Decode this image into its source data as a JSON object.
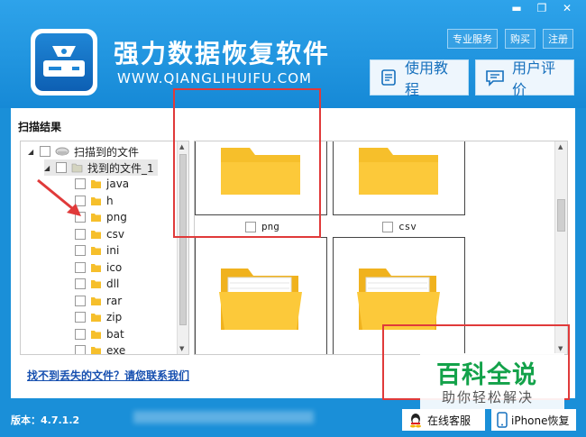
{
  "window": {
    "minimize": "▬",
    "restore": "❐",
    "close": "✕"
  },
  "app": {
    "title": "强力数据恢复软件",
    "url": "WWW.QIANGLIHUIFU.COM"
  },
  "top_links": [
    "专业服务",
    "购买",
    "注册"
  ],
  "buttons": {
    "tutorial": "使用教程",
    "review": "用户评价"
  },
  "panel": {
    "title": "扫描结果"
  },
  "tree": {
    "root": "扫描到的文件",
    "child": "找到的文件_1",
    "items": [
      "java",
      "h",
      "png",
      "csv",
      "ini",
      "ico",
      "dll",
      "rar",
      "zip",
      "bat",
      "exe"
    ]
  },
  "grid": {
    "labels": [
      "png",
      "csv"
    ]
  },
  "contact_link": "找不到丢失的文件？请您联系我们",
  "footer": {
    "version": "版本：4.7.1.2",
    "service": "在线客服",
    "iphone": "iPhone恢复"
  },
  "watermark": {
    "line1": "百科全说",
    "line2": "助你轻松解决"
  },
  "colors": {
    "folder": "#f6bf2b",
    "accent_red": "#e03a3a",
    "header_blue": "#1a8fd8"
  }
}
